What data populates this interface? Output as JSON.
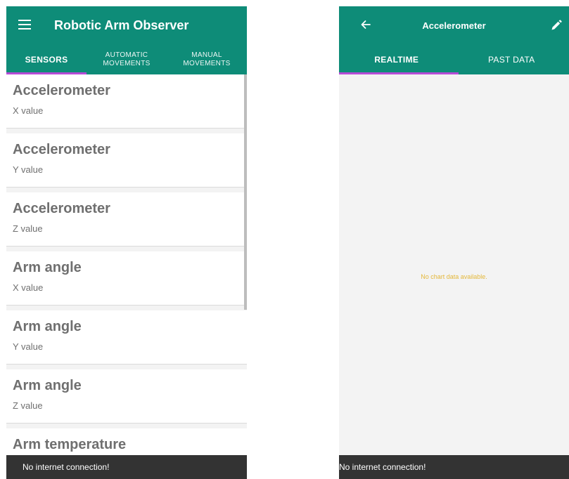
{
  "left_screen": {
    "app_title": "Robotic Arm Observer",
    "tabs": [
      {
        "label": "SENSORS",
        "active": true
      },
      {
        "label_line1": "AUTOMATIC",
        "label_line2": "MOVEMENTS",
        "active": false
      },
      {
        "label_line1": "MANUAL",
        "label_line2": "MOVEMENTS",
        "active": false
      }
    ],
    "sensors": [
      {
        "name": "Accelerometer",
        "axis": "X value"
      },
      {
        "name": "Accelerometer",
        "axis": "Y value"
      },
      {
        "name": "Accelerometer",
        "axis": "Z value"
      },
      {
        "name": "Arm angle",
        "axis": "X value"
      },
      {
        "name": "Arm angle",
        "axis": "Y value"
      },
      {
        "name": "Arm angle",
        "axis": "Z value"
      },
      {
        "name": "Arm temperature",
        "axis": ""
      }
    ],
    "snackbar": "No internet connection!"
  },
  "right_screen": {
    "title": "Accelerometer",
    "tabs": [
      {
        "label": "REALTIME",
        "active": true
      },
      {
        "label": "PAST DATA",
        "active": false
      }
    ],
    "empty_message": "No chart data available.",
    "snackbar": "No internet connection!"
  },
  "colors": {
    "app_bar": "#0e8c78",
    "tab_indicator": "#b64bd6",
    "empty_message": "#e4b83b",
    "snackbar": "#333333"
  }
}
